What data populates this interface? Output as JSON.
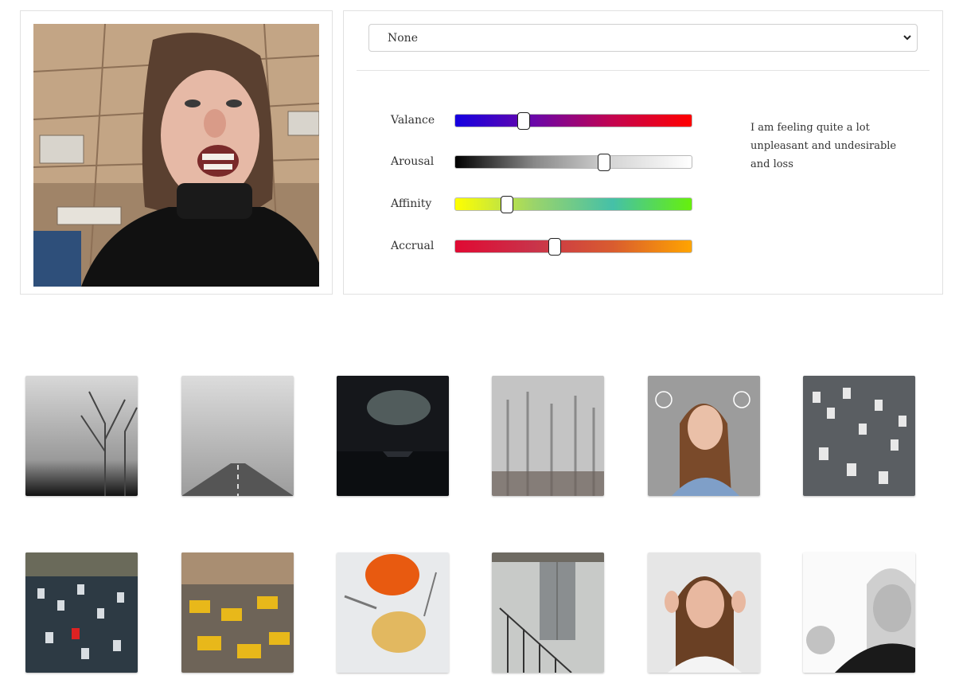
{
  "mood_select": {
    "value": "None"
  },
  "sliders": [
    {
      "label": "Valance",
      "value": 0.29
    },
    {
      "label": "Arousal",
      "value": 0.63
    },
    {
      "label": "Affinity",
      "value": 0.22
    },
    {
      "label": "Accrual",
      "value": 0.42
    }
  ],
  "feeling_text": "I am feeling quite a lot unpleasant and undesirable and loss",
  "main_photo": {
    "icon": "angry-woman-photo"
  },
  "gallery": [
    {
      "icon": "foggy-trees-photo"
    },
    {
      "icon": "foggy-road-photo"
    },
    {
      "icon": "dark-lake-boat-photo"
    },
    {
      "icon": "misty-forest-photo"
    },
    {
      "icon": "pensive-woman-photo"
    },
    {
      "icon": "highway-traffic-photo"
    },
    {
      "icon": "city-traffic-jam-photo"
    },
    {
      "icon": "yellow-buses-traffic-photo"
    },
    {
      "icon": "spilled-food-plate-photo"
    },
    {
      "icon": "elevator-stairs-photo"
    },
    {
      "icon": "woman-covering-ears-photo"
    },
    {
      "icon": "angry-fist-woman-photo"
    }
  ]
}
